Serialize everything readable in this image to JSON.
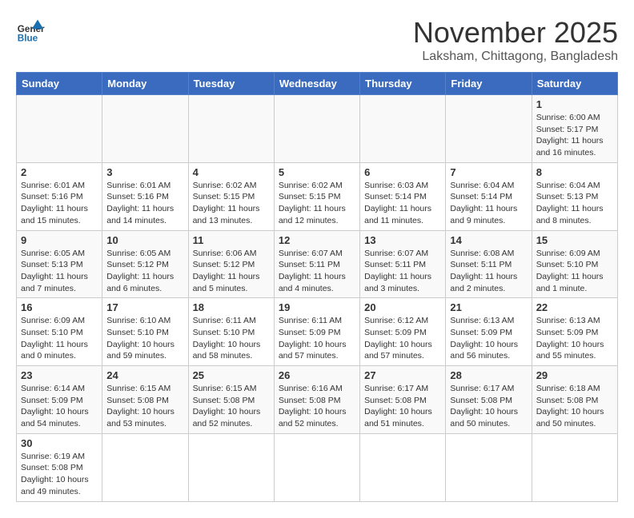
{
  "header": {
    "logo_general": "General",
    "logo_blue": "Blue",
    "title": "November 2025",
    "subtitle": "Laksham, Chittagong, Bangladesh"
  },
  "days_of_week": [
    "Sunday",
    "Monday",
    "Tuesday",
    "Wednesday",
    "Thursday",
    "Friday",
    "Saturday"
  ],
  "weeks": [
    [
      {
        "day": "",
        "info": ""
      },
      {
        "day": "",
        "info": ""
      },
      {
        "day": "",
        "info": ""
      },
      {
        "day": "",
        "info": ""
      },
      {
        "day": "",
        "info": ""
      },
      {
        "day": "",
        "info": ""
      },
      {
        "day": "1",
        "info": "Sunrise: 6:00 AM\nSunset: 5:17 PM\nDaylight: 11 hours and 16 minutes."
      }
    ],
    [
      {
        "day": "2",
        "info": "Sunrise: 6:01 AM\nSunset: 5:16 PM\nDaylight: 11 hours and 15 minutes."
      },
      {
        "day": "3",
        "info": "Sunrise: 6:01 AM\nSunset: 5:16 PM\nDaylight: 11 hours and 14 minutes."
      },
      {
        "day": "4",
        "info": "Sunrise: 6:02 AM\nSunset: 5:15 PM\nDaylight: 11 hours and 13 minutes."
      },
      {
        "day": "5",
        "info": "Sunrise: 6:02 AM\nSunset: 5:15 PM\nDaylight: 11 hours and 12 minutes."
      },
      {
        "day": "6",
        "info": "Sunrise: 6:03 AM\nSunset: 5:14 PM\nDaylight: 11 hours and 11 minutes."
      },
      {
        "day": "7",
        "info": "Sunrise: 6:04 AM\nSunset: 5:14 PM\nDaylight: 11 hours and 9 minutes."
      },
      {
        "day": "8",
        "info": "Sunrise: 6:04 AM\nSunset: 5:13 PM\nDaylight: 11 hours and 8 minutes."
      }
    ],
    [
      {
        "day": "9",
        "info": "Sunrise: 6:05 AM\nSunset: 5:13 PM\nDaylight: 11 hours and 7 minutes."
      },
      {
        "day": "10",
        "info": "Sunrise: 6:05 AM\nSunset: 5:12 PM\nDaylight: 11 hours and 6 minutes."
      },
      {
        "day": "11",
        "info": "Sunrise: 6:06 AM\nSunset: 5:12 PM\nDaylight: 11 hours and 5 minutes."
      },
      {
        "day": "12",
        "info": "Sunrise: 6:07 AM\nSunset: 5:11 PM\nDaylight: 11 hours and 4 minutes."
      },
      {
        "day": "13",
        "info": "Sunrise: 6:07 AM\nSunset: 5:11 PM\nDaylight: 11 hours and 3 minutes."
      },
      {
        "day": "14",
        "info": "Sunrise: 6:08 AM\nSunset: 5:11 PM\nDaylight: 11 hours and 2 minutes."
      },
      {
        "day": "15",
        "info": "Sunrise: 6:09 AM\nSunset: 5:10 PM\nDaylight: 11 hours and 1 minute."
      }
    ],
    [
      {
        "day": "16",
        "info": "Sunrise: 6:09 AM\nSunset: 5:10 PM\nDaylight: 11 hours and 0 minutes."
      },
      {
        "day": "17",
        "info": "Sunrise: 6:10 AM\nSunset: 5:10 PM\nDaylight: 10 hours and 59 minutes."
      },
      {
        "day": "18",
        "info": "Sunrise: 6:11 AM\nSunset: 5:10 PM\nDaylight: 10 hours and 58 minutes."
      },
      {
        "day": "19",
        "info": "Sunrise: 6:11 AM\nSunset: 5:09 PM\nDaylight: 10 hours and 57 minutes."
      },
      {
        "day": "20",
        "info": "Sunrise: 6:12 AM\nSunset: 5:09 PM\nDaylight: 10 hours and 57 minutes."
      },
      {
        "day": "21",
        "info": "Sunrise: 6:13 AM\nSunset: 5:09 PM\nDaylight: 10 hours and 56 minutes."
      },
      {
        "day": "22",
        "info": "Sunrise: 6:13 AM\nSunset: 5:09 PM\nDaylight: 10 hours and 55 minutes."
      }
    ],
    [
      {
        "day": "23",
        "info": "Sunrise: 6:14 AM\nSunset: 5:09 PM\nDaylight: 10 hours and 54 minutes."
      },
      {
        "day": "24",
        "info": "Sunrise: 6:15 AM\nSunset: 5:08 PM\nDaylight: 10 hours and 53 minutes."
      },
      {
        "day": "25",
        "info": "Sunrise: 6:15 AM\nSunset: 5:08 PM\nDaylight: 10 hours and 52 minutes."
      },
      {
        "day": "26",
        "info": "Sunrise: 6:16 AM\nSunset: 5:08 PM\nDaylight: 10 hours and 52 minutes."
      },
      {
        "day": "27",
        "info": "Sunrise: 6:17 AM\nSunset: 5:08 PM\nDaylight: 10 hours and 51 minutes."
      },
      {
        "day": "28",
        "info": "Sunrise: 6:17 AM\nSunset: 5:08 PM\nDaylight: 10 hours and 50 minutes."
      },
      {
        "day": "29",
        "info": "Sunrise: 6:18 AM\nSunset: 5:08 PM\nDaylight: 10 hours and 50 minutes."
      }
    ],
    [
      {
        "day": "30",
        "info": "Sunrise: 6:19 AM\nSunset: 5:08 PM\nDaylight: 10 hours and 49 minutes."
      },
      {
        "day": "",
        "info": ""
      },
      {
        "day": "",
        "info": ""
      },
      {
        "day": "",
        "info": ""
      },
      {
        "day": "",
        "info": ""
      },
      {
        "day": "",
        "info": ""
      },
      {
        "day": "",
        "info": ""
      }
    ]
  ]
}
